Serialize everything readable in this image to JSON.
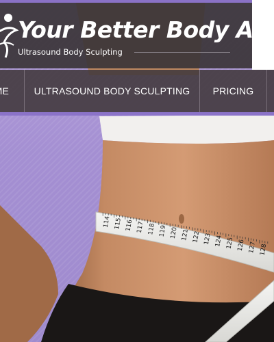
{
  "site": {
    "title": "Your Better Body AZ",
    "tagline": "Ultrasound Body Sculpting"
  },
  "nav": {
    "items": [
      {
        "label": "HOME",
        "visible_text": "ME"
      },
      {
        "label": "ULTRASOUND BODY SCULPTING"
      },
      {
        "label": "PRICING"
      }
    ]
  },
  "hero": {
    "tape_numbers": [
      "114",
      "115",
      "116",
      "117",
      "118",
      "119",
      "120",
      "121",
      "122",
      "123",
      "124",
      "125",
      "126",
      "127",
      "128"
    ]
  },
  "colors": {
    "accent": "#8b73c8",
    "header_bg": "#3a3437",
    "nav_bg": "#423a3e",
    "backdrop": "#a48fd2"
  }
}
